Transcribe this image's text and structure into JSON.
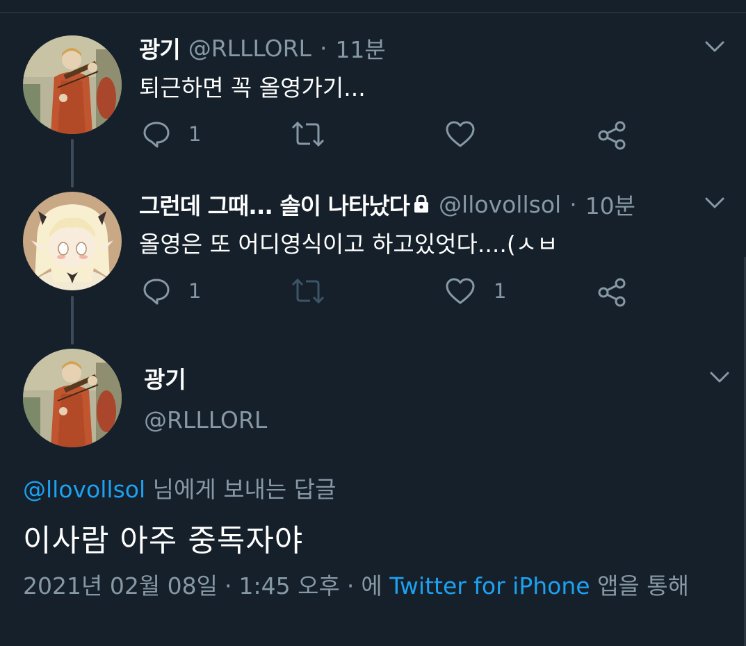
{
  "colors": {
    "background": "#15202b",
    "text": "#ffffff",
    "secondary_text": "#8899a6",
    "link": "#1da1f2",
    "divider": "#38444d"
  },
  "tweets": [
    {
      "display_name": "광기",
      "handle": "@RLLLORL",
      "separator": "·",
      "time": "11분",
      "text": "퇴근하면 꼭 올영가기...",
      "reply_count": "1",
      "retweet_count": "",
      "like_count": ""
    },
    {
      "display_name": "그런데 그때... 솔이 나타났다",
      "protected_icon": "lock-icon",
      "handle": "@llovollsol",
      "separator": "·",
      "time": "10분",
      "text": "올영은 또 어디영식이고 하고있엇다....(ㅅㅂ",
      "reply_count": "1",
      "retweet_count": "",
      "like_count": "1"
    }
  ],
  "focus_tweet": {
    "display_name": "광기",
    "handle": "@RLLLORL",
    "reply_to_handle": "@llovollsol",
    "reply_to_suffix": " 님에게 보내는 답글",
    "text": "이사람 아주 중독자야",
    "date": "2021년 02월 08일",
    "separator": "·",
    "time": "1:45 오후",
    "via_prefix": "에 ",
    "source": "Twitter for iPhone",
    "via_suffix": " 앱을 통해"
  },
  "icons": {
    "reply": "reply-icon",
    "retweet": "retweet-icon",
    "like": "heart-icon",
    "share": "share-icon",
    "menu": "chevron-down-icon"
  }
}
